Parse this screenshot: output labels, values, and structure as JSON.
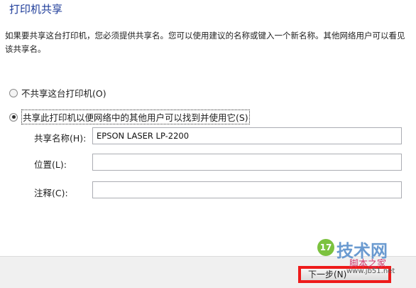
{
  "title": "打印机共享",
  "description": "如果要共享这台打印机，您必须提供共享名。您可以使用建议的名称或键入一个新名称。其他网络用户可以看见该共享名。",
  "options": {
    "no_share": "不共享这台打印机(O)",
    "share": "共享此打印机以便网络中的其他用户可以找到并使用它(S)"
  },
  "fields": {
    "share_name_label": "共享名称(H):",
    "share_name_value": "EPSON LASER LP-2200",
    "location_label": "位置(L):",
    "location_value": "",
    "comment_label": "注释(C):",
    "comment_value": ""
  },
  "buttons": {
    "next": "下一步(N)"
  },
  "watermark": {
    "logo": "17",
    "main": "技术网",
    "sub": "脚本之家",
    "url": "www.jb51.net"
  },
  "colors": {
    "title": "#1f3d9a",
    "highlight_border": "#ee1b1b",
    "footer_bg": "#f0f0f0"
  }
}
